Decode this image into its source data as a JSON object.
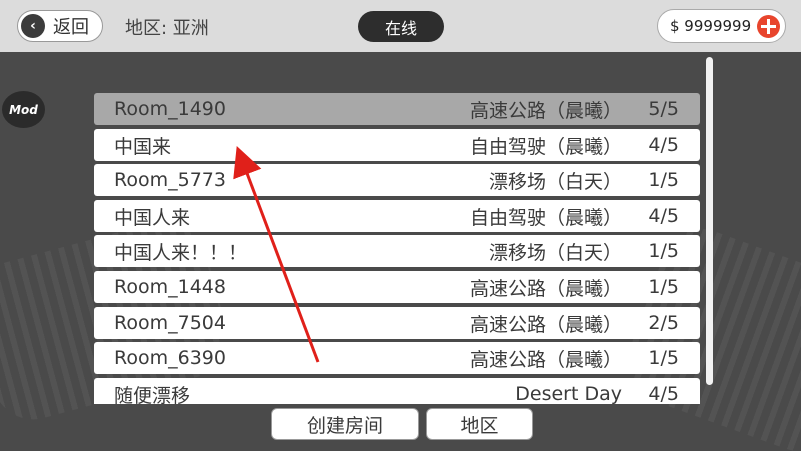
{
  "header": {
    "back_label": "返回",
    "region_label": "地区: 亚洲",
    "status_tab": "在线",
    "money": "$ 9999999"
  },
  "mod_badge": "Mod",
  "rooms": [
    {
      "name": "Room_1490",
      "map": "高速公路（晨曦）",
      "players": "5/5",
      "selected": true
    },
    {
      "name": "中国来",
      "map": "自由驾驶（晨曦）",
      "players": "4/5"
    },
    {
      "name": "Room_5773",
      "map": "漂移场（白天）",
      "players": "1/5"
    },
    {
      "name": "中国人来",
      "map": "自由驾驶（晨曦）",
      "players": "4/5"
    },
    {
      "name": "中国人来！！！",
      "map": "漂移场（白天）",
      "players": "1/5"
    },
    {
      "name": "Room_1448",
      "map": "高速公路（晨曦）",
      "players": "1/5"
    },
    {
      "name": "Room_7504",
      "map": "高速公路（晨曦）",
      "players": "2/5"
    },
    {
      "name": "Room_6390",
      "map": "高速公路（晨曦）",
      "players": "1/5"
    },
    {
      "name": "随便漂移",
      "map": "Desert Day",
      "players": "4/5"
    }
  ],
  "footer": {
    "create_room": "创建房间",
    "region": "地区"
  },
  "colors": {
    "accent_red": "#e8452d",
    "selected_row": "#a8a8a8"
  }
}
